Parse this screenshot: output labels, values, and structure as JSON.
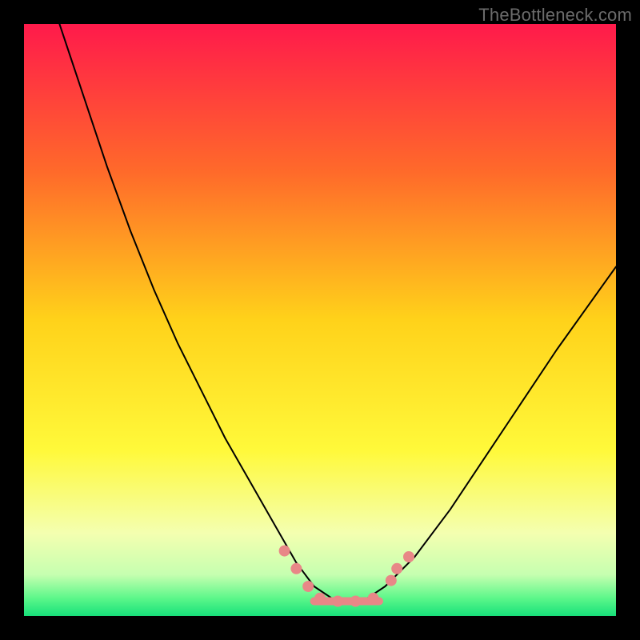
{
  "watermark": {
    "text": "TheBottleneck.com"
  },
  "chart_data": {
    "type": "line",
    "title": "",
    "xlabel": "",
    "ylabel": "",
    "xlim": [
      0,
      100
    ],
    "ylim": [
      0,
      100
    ],
    "grid": false,
    "legend": false,
    "background_gradient": {
      "stops": [
        {
          "offset": 0.0,
          "color": "#ff1a4b"
        },
        {
          "offset": 0.25,
          "color": "#ff6a2a"
        },
        {
          "offset": 0.5,
          "color": "#ffd21a"
        },
        {
          "offset": 0.72,
          "color": "#fff93a"
        },
        {
          "offset": 0.86,
          "color": "#f4ffb0"
        },
        {
          "offset": 0.93,
          "color": "#c6ffb0"
        },
        {
          "offset": 0.97,
          "color": "#5cf78a"
        },
        {
          "offset": 1.0,
          "color": "#17e07a"
        }
      ]
    },
    "series": [
      {
        "name": "bottleneck-curve",
        "color": "#000000",
        "stroke_width": 2,
        "x": [
          6,
          10,
          14,
          18,
          22,
          26,
          30,
          34,
          38,
          42,
          46,
          49,
          52,
          55,
          58,
          61,
          66,
          72,
          78,
          84,
          90,
          95,
          100
        ],
        "y": [
          100,
          88,
          76,
          65,
          55,
          46,
          38,
          30,
          23,
          16,
          9,
          5,
          3,
          2.5,
          3,
          5,
          10,
          18,
          27,
          36,
          45,
          52,
          59
        ]
      }
    ],
    "markers": {
      "name": "valley-markers",
      "color": "#e88787",
      "radius_px": 7,
      "points": [
        {
          "x": 44,
          "y": 11
        },
        {
          "x": 46,
          "y": 8
        },
        {
          "x": 48,
          "y": 5
        },
        {
          "x": 50,
          "y": 3
        },
        {
          "x": 53,
          "y": 2.5
        },
        {
          "x": 56,
          "y": 2.5
        },
        {
          "x": 59,
          "y": 3
        },
        {
          "x": 62,
          "y": 6
        },
        {
          "x": 63,
          "y": 8
        },
        {
          "x": 65,
          "y": 10
        }
      ]
    },
    "valley_bar": {
      "color": "#e88787",
      "x_start": 49,
      "x_end": 60,
      "y": 2.5,
      "thickness_px": 10
    }
  }
}
